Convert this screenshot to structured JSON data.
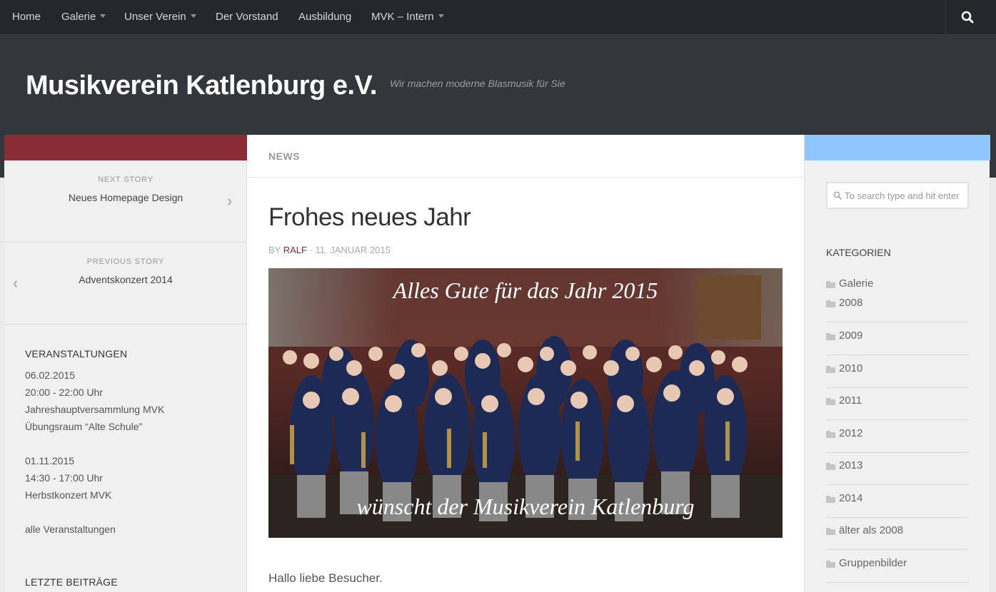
{
  "nav": {
    "items": [
      {
        "label": "Home",
        "dropdown": false
      },
      {
        "label": "Galerie",
        "dropdown": true
      },
      {
        "label": "Unser Verein",
        "dropdown": true
      },
      {
        "label": "Der Vorstand",
        "dropdown": false
      },
      {
        "label": "Ausbildung",
        "dropdown": false
      },
      {
        "label": "MVK – Intern",
        "dropdown": true
      }
    ],
    "search_icon": "search-icon"
  },
  "header": {
    "title": "Musikverein Katlenburg e.V.",
    "tagline": "Wir machen moderne Blasmusik für Sie"
  },
  "colors": {
    "topbar": "#26272b",
    "header": "#33363b",
    "accent_left": "#892c35",
    "accent_right": "#8fc6ff"
  },
  "left_sidebar": {
    "next_story": {
      "label": "NEXT STORY",
      "title": "Neues Homepage Design"
    },
    "previous_story": {
      "label": "PREVIOUS STORY",
      "title": "Adventskonzert 2014"
    },
    "events": {
      "heading": "VERANSTALTUNGEN",
      "items": [
        {
          "date": "06.02.2015",
          "time": "20:00 - 22:00 Uhr",
          "title": "Jahreshauptversammlung MVK",
          "location": "Übungsraum “Alte Schule”"
        },
        {
          "date": "01.11.2015",
          "time": "14:30 - 17:00 Uhr",
          "title": "Herbstkonzert MVK"
        }
      ],
      "all_link": "alle Veranstaltungen"
    },
    "recent_heading": "LETZTE BEITRÄGE"
  },
  "main": {
    "section": "NEWS",
    "post": {
      "title": "Frohes neues Jahr",
      "by": "BY",
      "author": "RALF",
      "separator": "·",
      "date": "11. JANUAR 2015",
      "image_caption_top": "Alles Gute für das Jahr 2015",
      "image_caption_bottom": "wünscht der Musikverein Katlenburg",
      "intro": "Hallo liebe Besucher."
    }
  },
  "right_sidebar": {
    "search_placeholder": "To search type and hit enter",
    "categories_heading": "KATEGORIEN",
    "categories": [
      "Galerie",
      "2008",
      "2009",
      "2010",
      "2011",
      "2012",
      "2013",
      "2014",
      "älter als 2008",
      "Gruppenbilder"
    ]
  }
}
